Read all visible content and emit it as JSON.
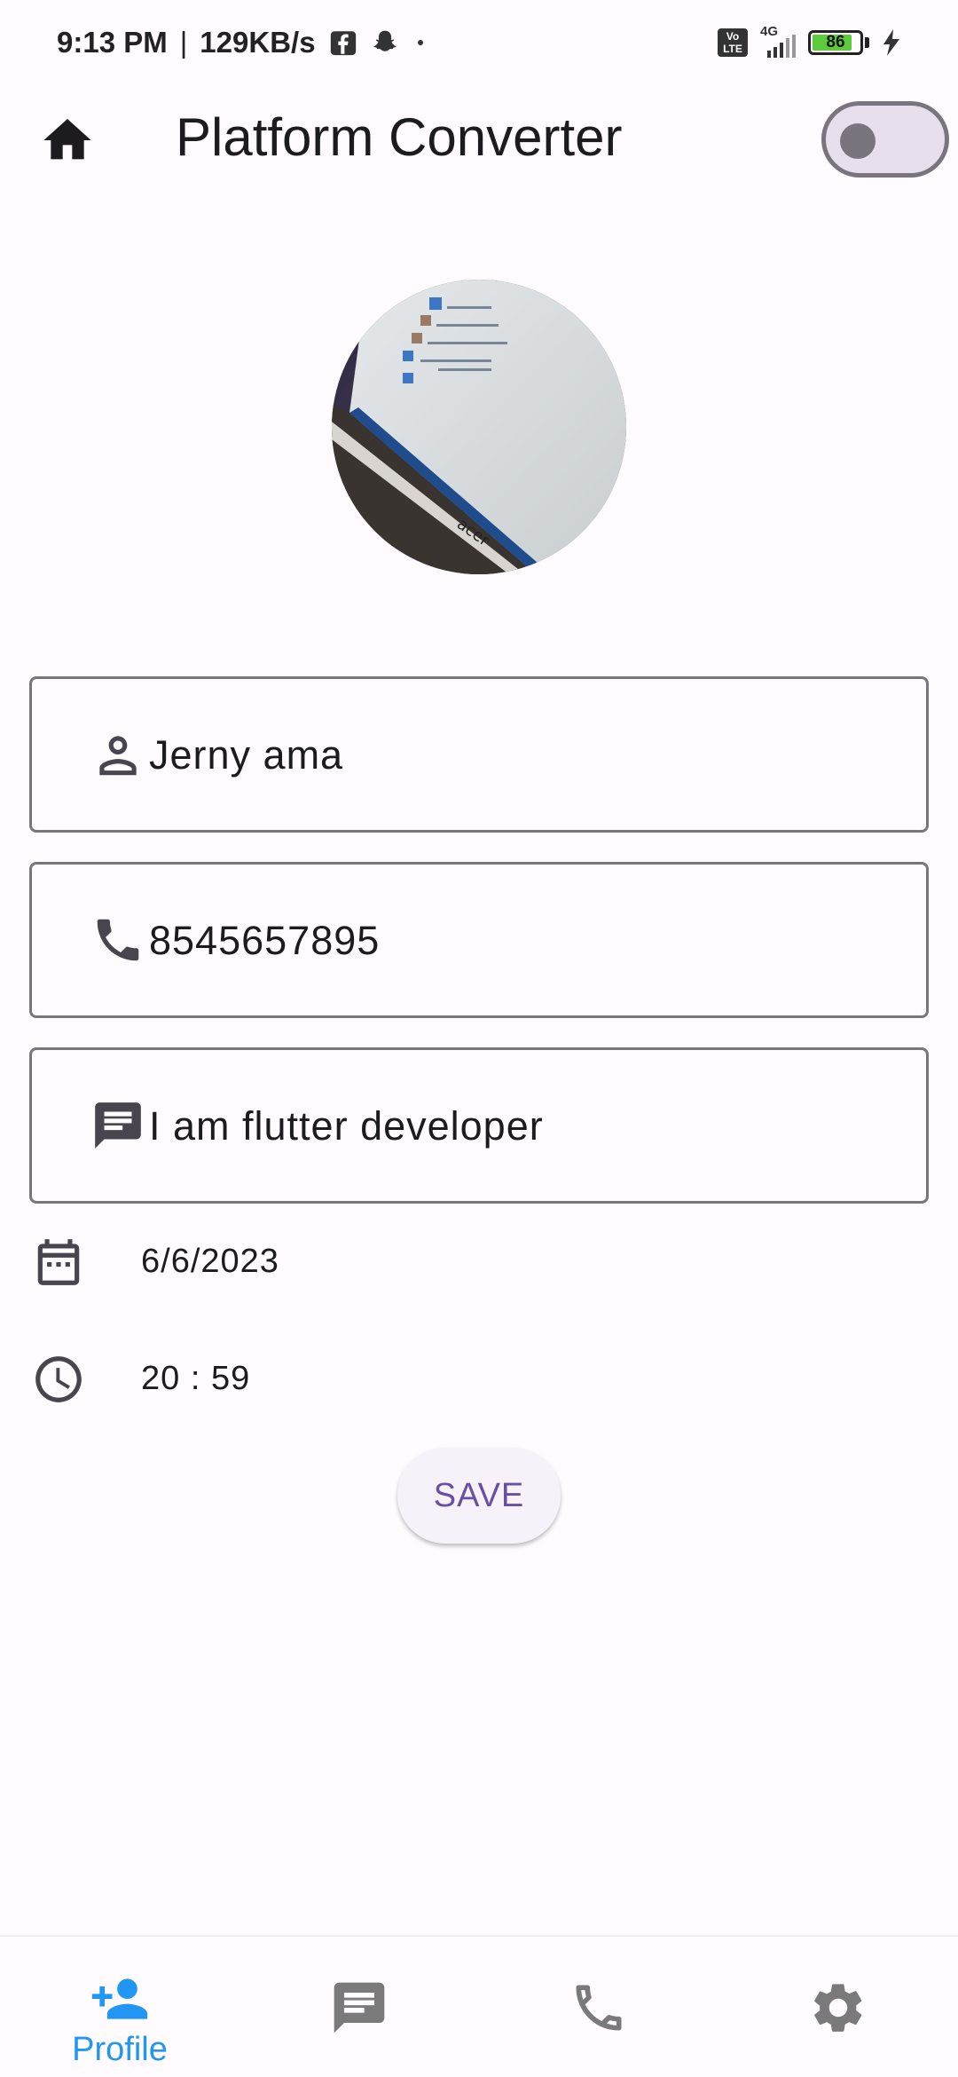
{
  "status_bar": {
    "time": "9:13 PM",
    "separator": "|",
    "network_speed": "129KB/s",
    "notification_icons": [
      "facebook-icon",
      "snapchat-icon",
      "dot-icon"
    ],
    "volte_label": "Vo\nLTE",
    "network_type": "4G",
    "battery_level": "86",
    "battery_fraction": 0.86,
    "charging": true
  },
  "app_bar": {
    "title": "Platform Converter",
    "leading_icon": "home-icon",
    "toggle_on": false
  },
  "profile": {
    "avatar_icon": "profile-photo"
  },
  "form": {
    "name_value": "Jerny ama",
    "phone_value": "8545657895",
    "bio_value": "I am flutter developer",
    "date_value": "6/6/2023",
    "time_value": "20 : 59",
    "save_label": "SAVE"
  },
  "bottom_nav": {
    "items": [
      {
        "label": "Profile",
        "icon": "add-person-icon",
        "active": true
      },
      {
        "label": "",
        "icon": "chat-icon",
        "active": false
      },
      {
        "label": "",
        "icon": "phone-icon",
        "active": false
      },
      {
        "label": "",
        "icon": "settings-icon",
        "active": false
      }
    ]
  },
  "colors": {
    "background": "#fffbfe",
    "accent": "#6750a4",
    "nav_active": "#2196f3",
    "nav_inactive": "#7a7a7a",
    "outline": "#79747e"
  }
}
